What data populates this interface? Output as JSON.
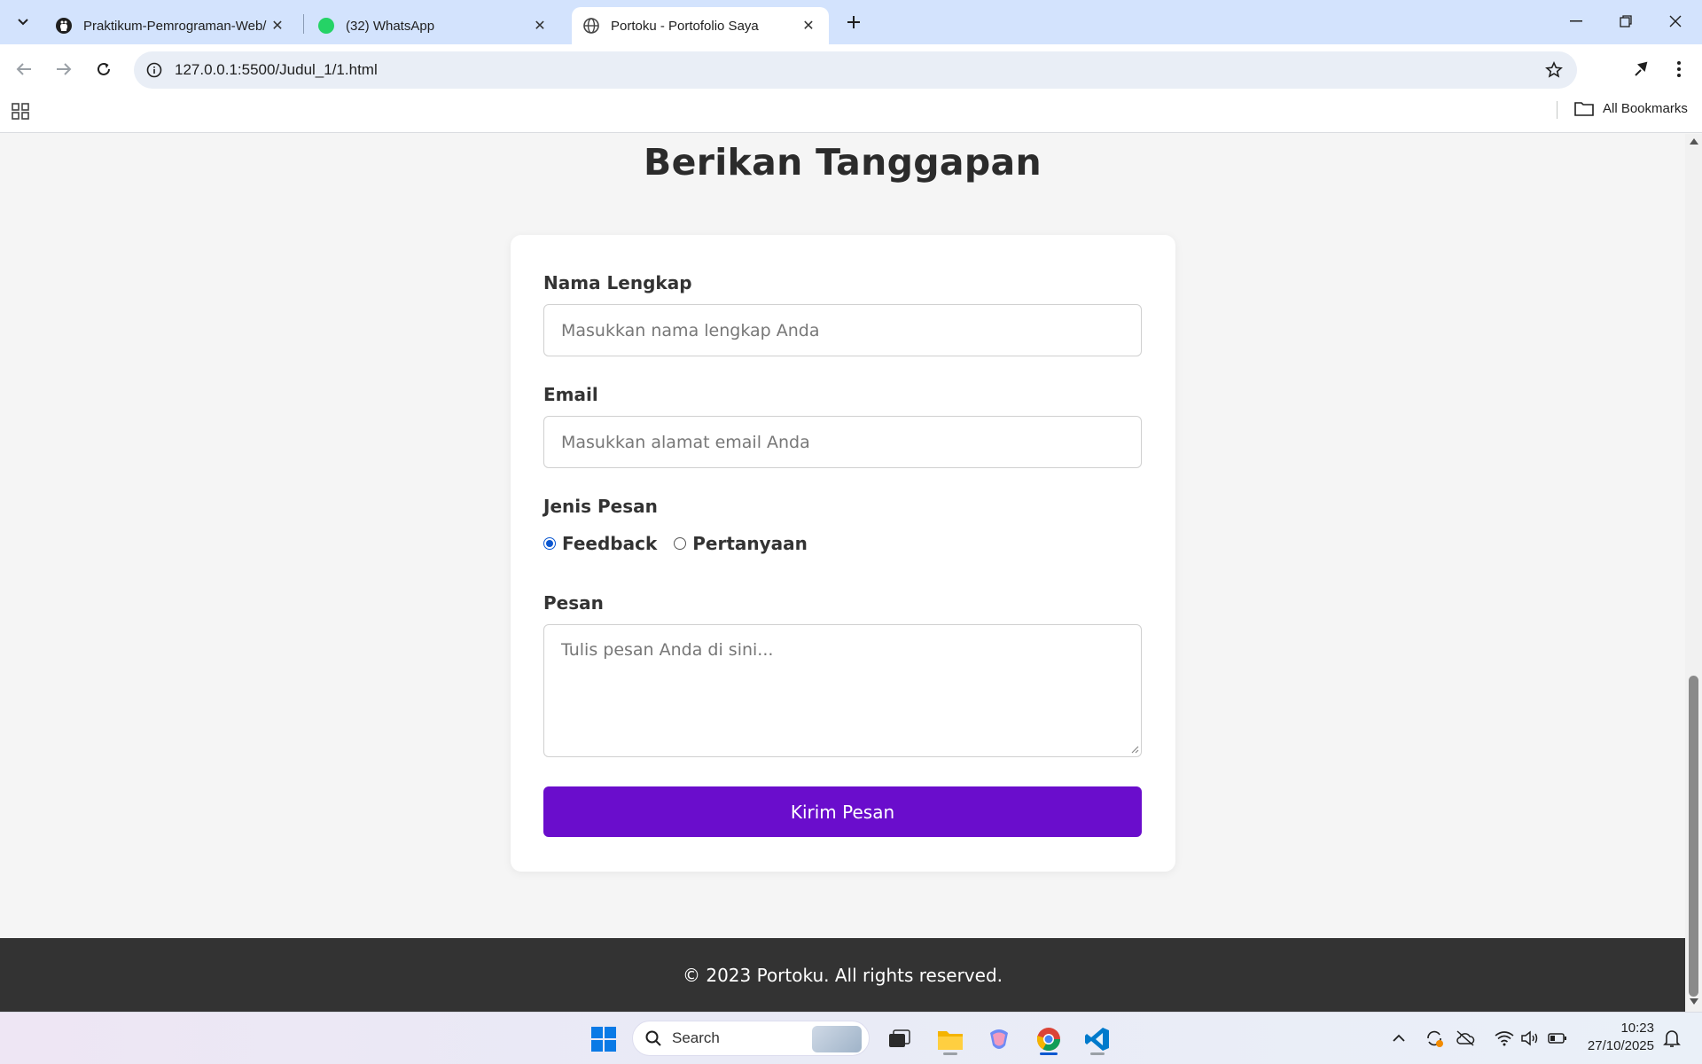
{
  "browser": {
    "tabs": [
      {
        "title": "Praktikum-Pemrograman-Web/",
        "favicon": "github-icon",
        "active": false
      },
      {
        "title": "(32) WhatsApp",
        "favicon": "whatsapp-icon",
        "badge": "32",
        "active": false
      },
      {
        "title": "Portoku - Portofolio Saya",
        "favicon": "globe-icon",
        "active": true
      }
    ],
    "url": "127.0.0.1:5500/Judul_1/1.html",
    "bookmarks_label": "All Bookmarks"
  },
  "page": {
    "heading": "Berikan Tanggapan",
    "form": {
      "name_label": "Nama Lengkap",
      "name_placeholder": "Masukkan nama lengkap Anda",
      "email_label": "Email",
      "email_placeholder": "Masukkan alamat email Anda",
      "type_label": "Jenis Pesan",
      "type_options": [
        {
          "label": "Feedback",
          "checked": true
        },
        {
          "label": "Pertanyaan",
          "checked": false
        }
      ],
      "message_label": "Pesan",
      "message_placeholder": "Tulis pesan Anda di sini...",
      "submit_label": "Kirim Pesan"
    },
    "footer_text": "© 2023 Portoku. All rights reserved.",
    "accent_color": "#6a0dcc"
  },
  "taskbar": {
    "search_label": "Search",
    "time": "10:23",
    "date": "27/10/2025"
  }
}
